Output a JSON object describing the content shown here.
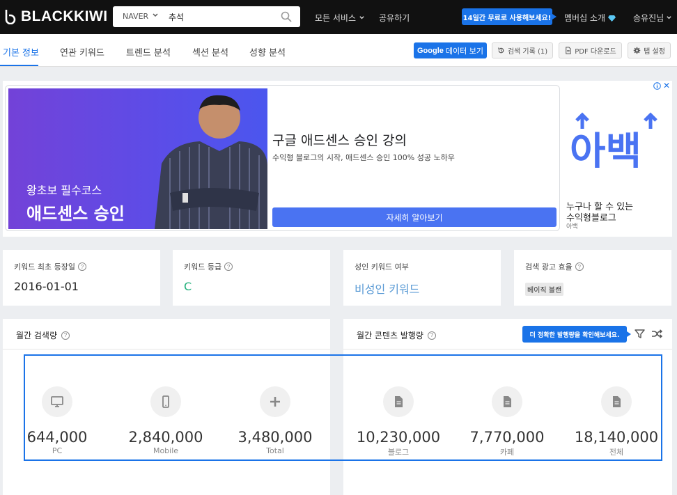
{
  "header": {
    "logo_text": "BLACKKIWI",
    "search": {
      "source": "NAVER",
      "query": "추석"
    },
    "nav": {
      "all_services": "모든 서비스",
      "share": "공유하기"
    },
    "trial_label": "14일간 무료로 사용해보세요!",
    "membership_label": "멤버십 소개",
    "user_label": "송유진님"
  },
  "tabs": [
    {
      "label": "기본 정보",
      "active": true
    },
    {
      "label": "연관 키워드"
    },
    {
      "label": "트렌드 분석"
    },
    {
      "label": "섹션 분석"
    },
    {
      "label": "성향 분석"
    }
  ],
  "toolbar": {
    "google_prefix": "Google",
    "google_suffix": "데이터 보기",
    "history": "검색 기록 (1)",
    "pdf": "PDF 다운로드",
    "page_settings": "탭 설정"
  },
  "ad": {
    "image_sub": "왕초보 필수코스",
    "image_main": "애드센스 승인",
    "title": "구글 애드센스 승인 강의",
    "description": "수익형 블로그의 시작, 애드센스 승인 100% 성공 노하우",
    "cta": "자세히 알아보기",
    "side_logo": "아백",
    "side_line1": "누구나 할 수 있는",
    "side_line2": "수익형블로그",
    "side_source": "아백"
  },
  "cards": [
    {
      "label": "키워드 최초 등장일",
      "value": "2016-01-01"
    },
    {
      "label": "키워드 등급",
      "value": "C"
    },
    {
      "label": "성인 키워드 여부",
      "value": "비성인 키워드"
    },
    {
      "label": "검색 광고 효율",
      "value": "베이직 블랜"
    }
  ],
  "colors": {
    "accent": "#1a73e8",
    "grade": "#1fb07a",
    "adult_value": "#5b9bd5"
  },
  "monthly_search": {
    "title": "월간 검색량",
    "items": [
      {
        "icon": "monitor-icon",
        "value": "644,000",
        "label": "PC"
      },
      {
        "icon": "mobile-icon",
        "value": "2,840,000",
        "label": "Mobile"
      },
      {
        "icon": "plus-icon",
        "value": "3,480,000",
        "label": "Total"
      }
    ]
  },
  "monthly_content": {
    "title": "월간 콘텐츠 발행량",
    "hint": "더 정확한 발행량을 확인해보세요.",
    "items": [
      {
        "icon": "document-icon",
        "value": "10,230,000",
        "label": "블로그"
      },
      {
        "icon": "document-icon",
        "value": "7,770,000",
        "label": "카페"
      },
      {
        "icon": "document-icon",
        "value": "18,140,000",
        "label": "전체"
      }
    ]
  }
}
